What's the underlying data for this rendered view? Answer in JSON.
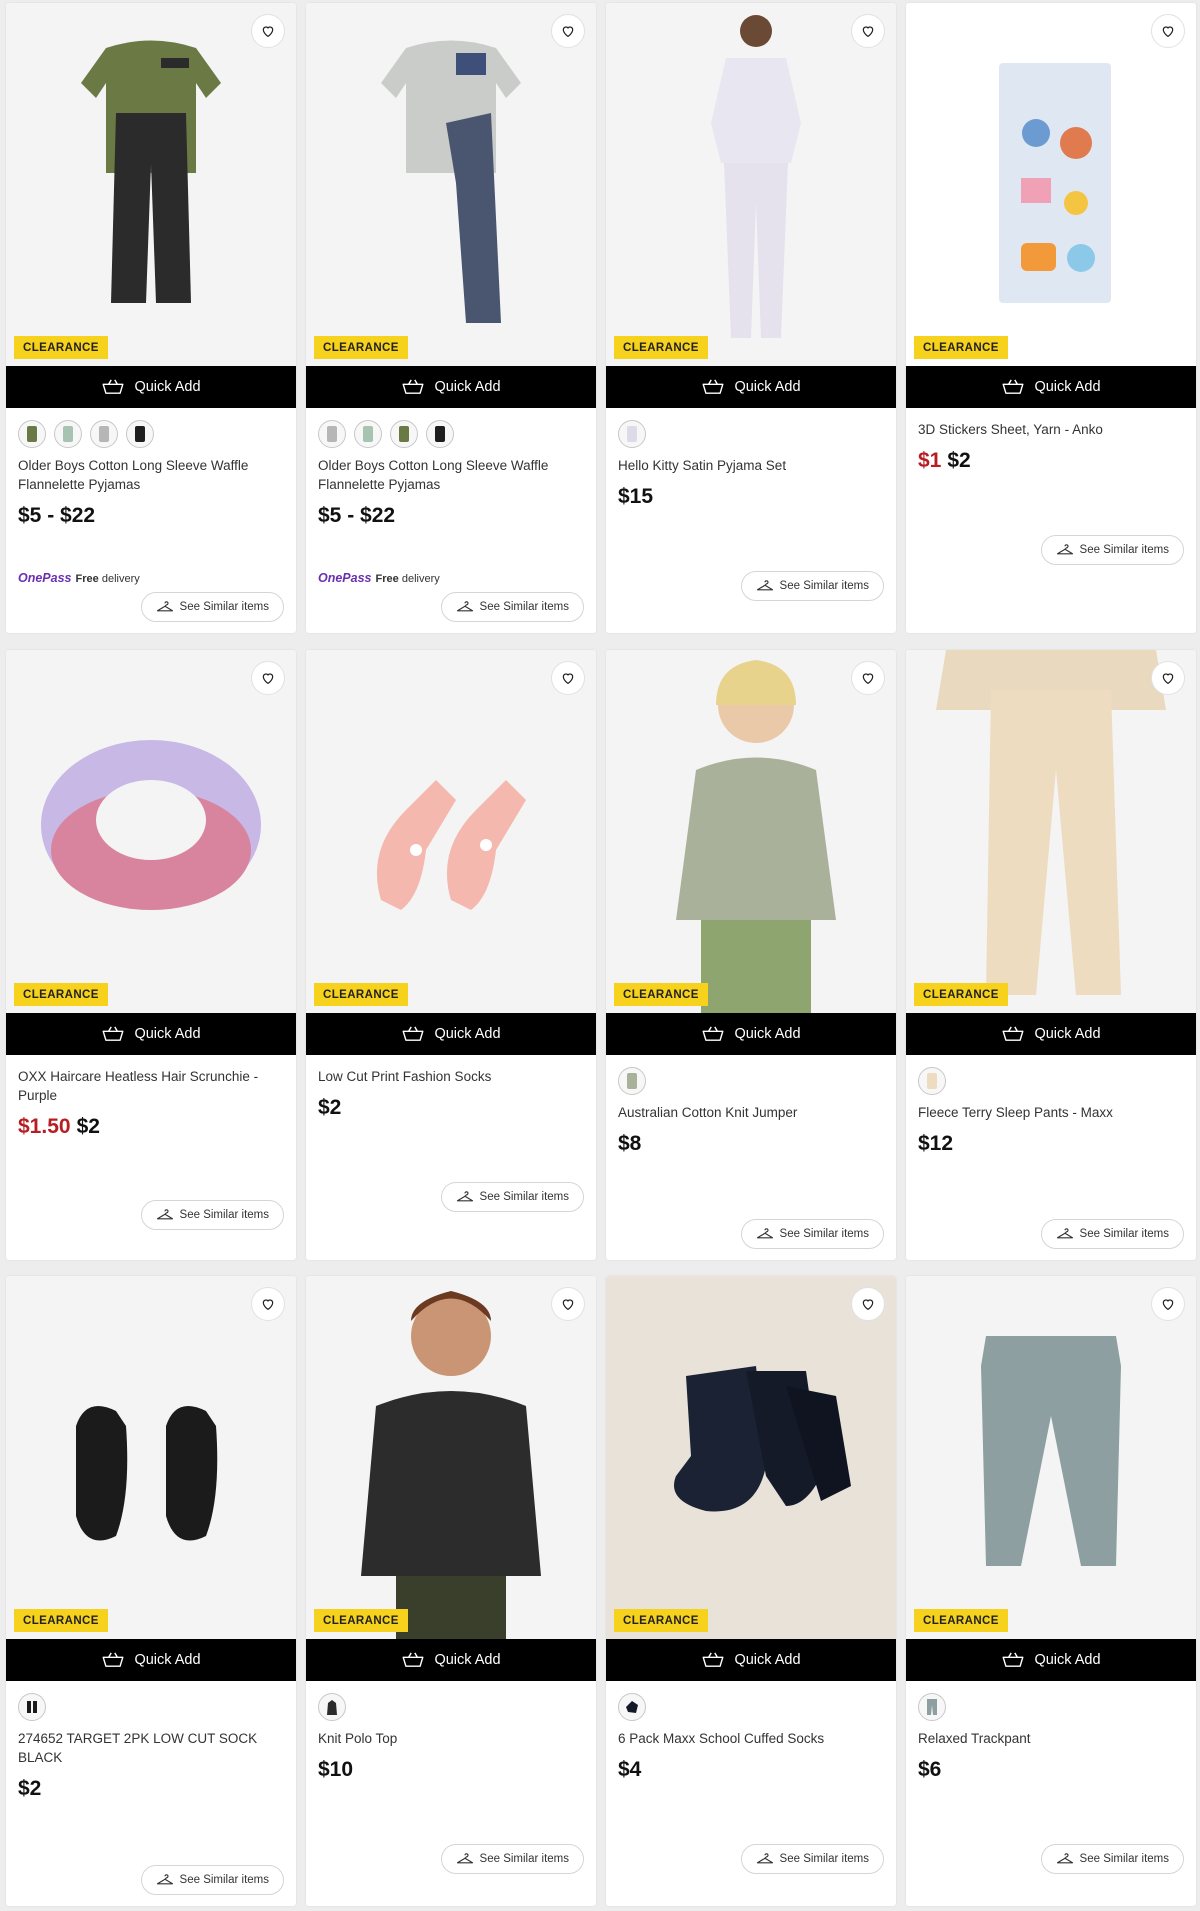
{
  "labels": {
    "badge": "CLEARANCE",
    "quick_add": "Quick Add",
    "see_similar": "See Similar items",
    "onepass_brand": "OnePass",
    "onepass_free": "Free",
    "onepass_delivery": "delivery"
  },
  "colors": {
    "badge": "#f7d21c",
    "sale_price": "#b61e23",
    "onepass": "#6b2fb3"
  },
  "products": [
    {
      "name": "Older Boys Cotton Long Sleeve Waffle Flannelette Pyjamas",
      "price": "$5 - $22",
      "swatch_count": 4,
      "onepass": true
    },
    {
      "name": "Older Boys Cotton Long Sleeve Waffle Flannelette Pyjamas",
      "price": "$5 - $22",
      "swatch_count": 4,
      "onepass": true
    },
    {
      "name": "Hello Kitty Satin Pyjama Set",
      "price": "$15",
      "swatch_count": 1
    },
    {
      "name": "3D Stickers Sheet, Yarn - Anko",
      "sale_price": "$1",
      "price": "$2",
      "swatch_count": 0
    },
    {
      "name": "OXX Haircare Heatless Hair Scrunchie - Purple",
      "sale_price": "$1.50",
      "price": "$2",
      "swatch_count": 0
    },
    {
      "name": "Low Cut Print Fashion Socks",
      "price": "$2",
      "swatch_count": 0
    },
    {
      "name": "Australian Cotton Knit Jumper",
      "price": "$8",
      "swatch_count": 1
    },
    {
      "name": "Fleece Terry Sleep Pants - Maxx",
      "price": "$12",
      "swatch_count": 1
    },
    {
      "name": "274652 TARGET 2PK LOW CUT SOCK BLACK",
      "price": "$2",
      "swatch_count": 1
    },
    {
      "name": "Knit Polo Top",
      "price": "$10",
      "swatch_count": 1
    },
    {
      "name": "6 Pack Maxx School Cuffed Socks",
      "price": "$4",
      "swatch_count": 1
    },
    {
      "name": "Relaxed Trackpant",
      "price": "$6",
      "swatch_count": 1
    }
  ]
}
